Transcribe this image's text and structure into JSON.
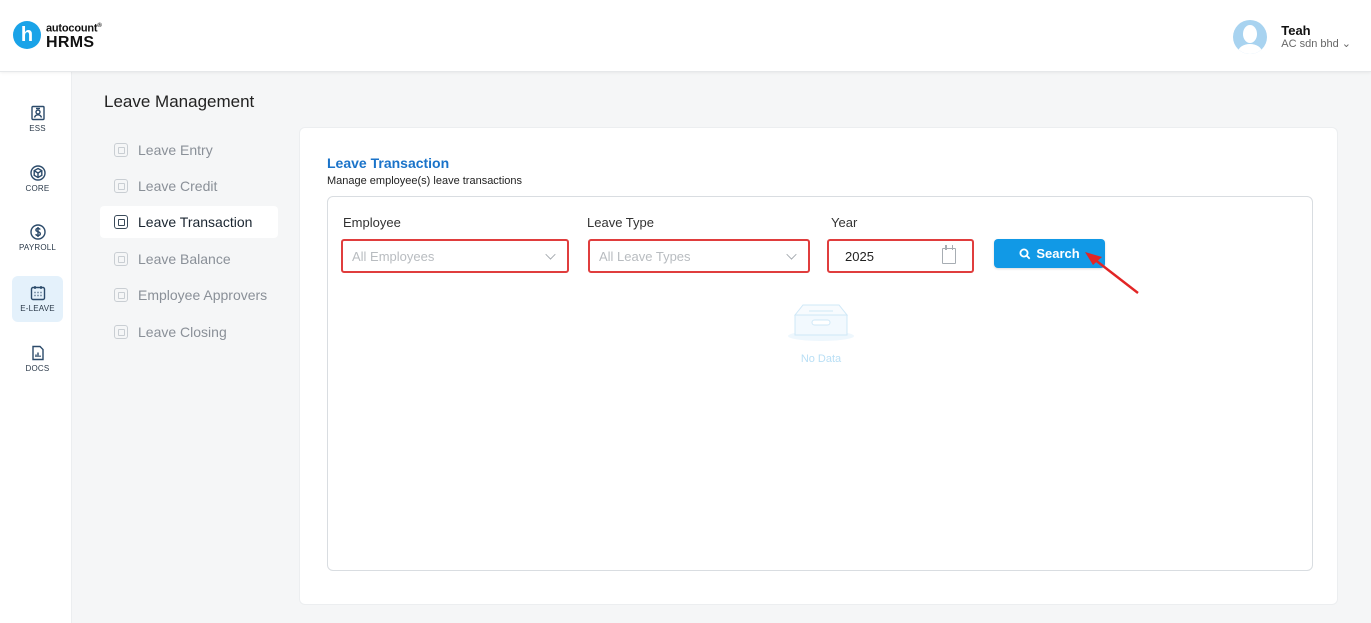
{
  "header": {
    "brand": "autocount",
    "brand_mark": "®",
    "logo_letter": "h",
    "product": "HRMS",
    "user_name": "Teah",
    "company": "AC sdn bhd",
    "company_chevron": "⌄"
  },
  "rail": {
    "items": [
      {
        "label": "ESS",
        "icon": "id-card-icon"
      },
      {
        "label": "CORE",
        "icon": "cube-icon"
      },
      {
        "label": "PAYROLL",
        "icon": "dollar-icon"
      },
      {
        "label": "E-LEAVE",
        "icon": "calendar-icon",
        "active": true
      },
      {
        "label": "DOCS",
        "icon": "document-chart-icon"
      }
    ]
  },
  "menu": {
    "title": "Leave Management",
    "items": [
      {
        "label": "Leave Entry"
      },
      {
        "label": "Leave Credit"
      },
      {
        "label": "Leave Transaction",
        "active": true
      },
      {
        "label": "Leave Balance"
      },
      {
        "label": "Employee Approvers"
      },
      {
        "label": "Leave Closing"
      }
    ]
  },
  "page": {
    "title": "Leave Transaction",
    "subtitle": "Manage employee(s) leave transactions"
  },
  "filters": {
    "employee_label": "Employee",
    "employee_placeholder": "All Employees",
    "leave_type_label": "Leave Type",
    "leave_type_placeholder": "All Leave Types",
    "year_label": "Year",
    "year_value": "2025",
    "search_label": "Search"
  },
  "empty_state": {
    "text": "No Data"
  },
  "colors": {
    "accent": "#1199e6",
    "title_blue": "#1a73c9",
    "highlight_red": "#e03d3d"
  }
}
